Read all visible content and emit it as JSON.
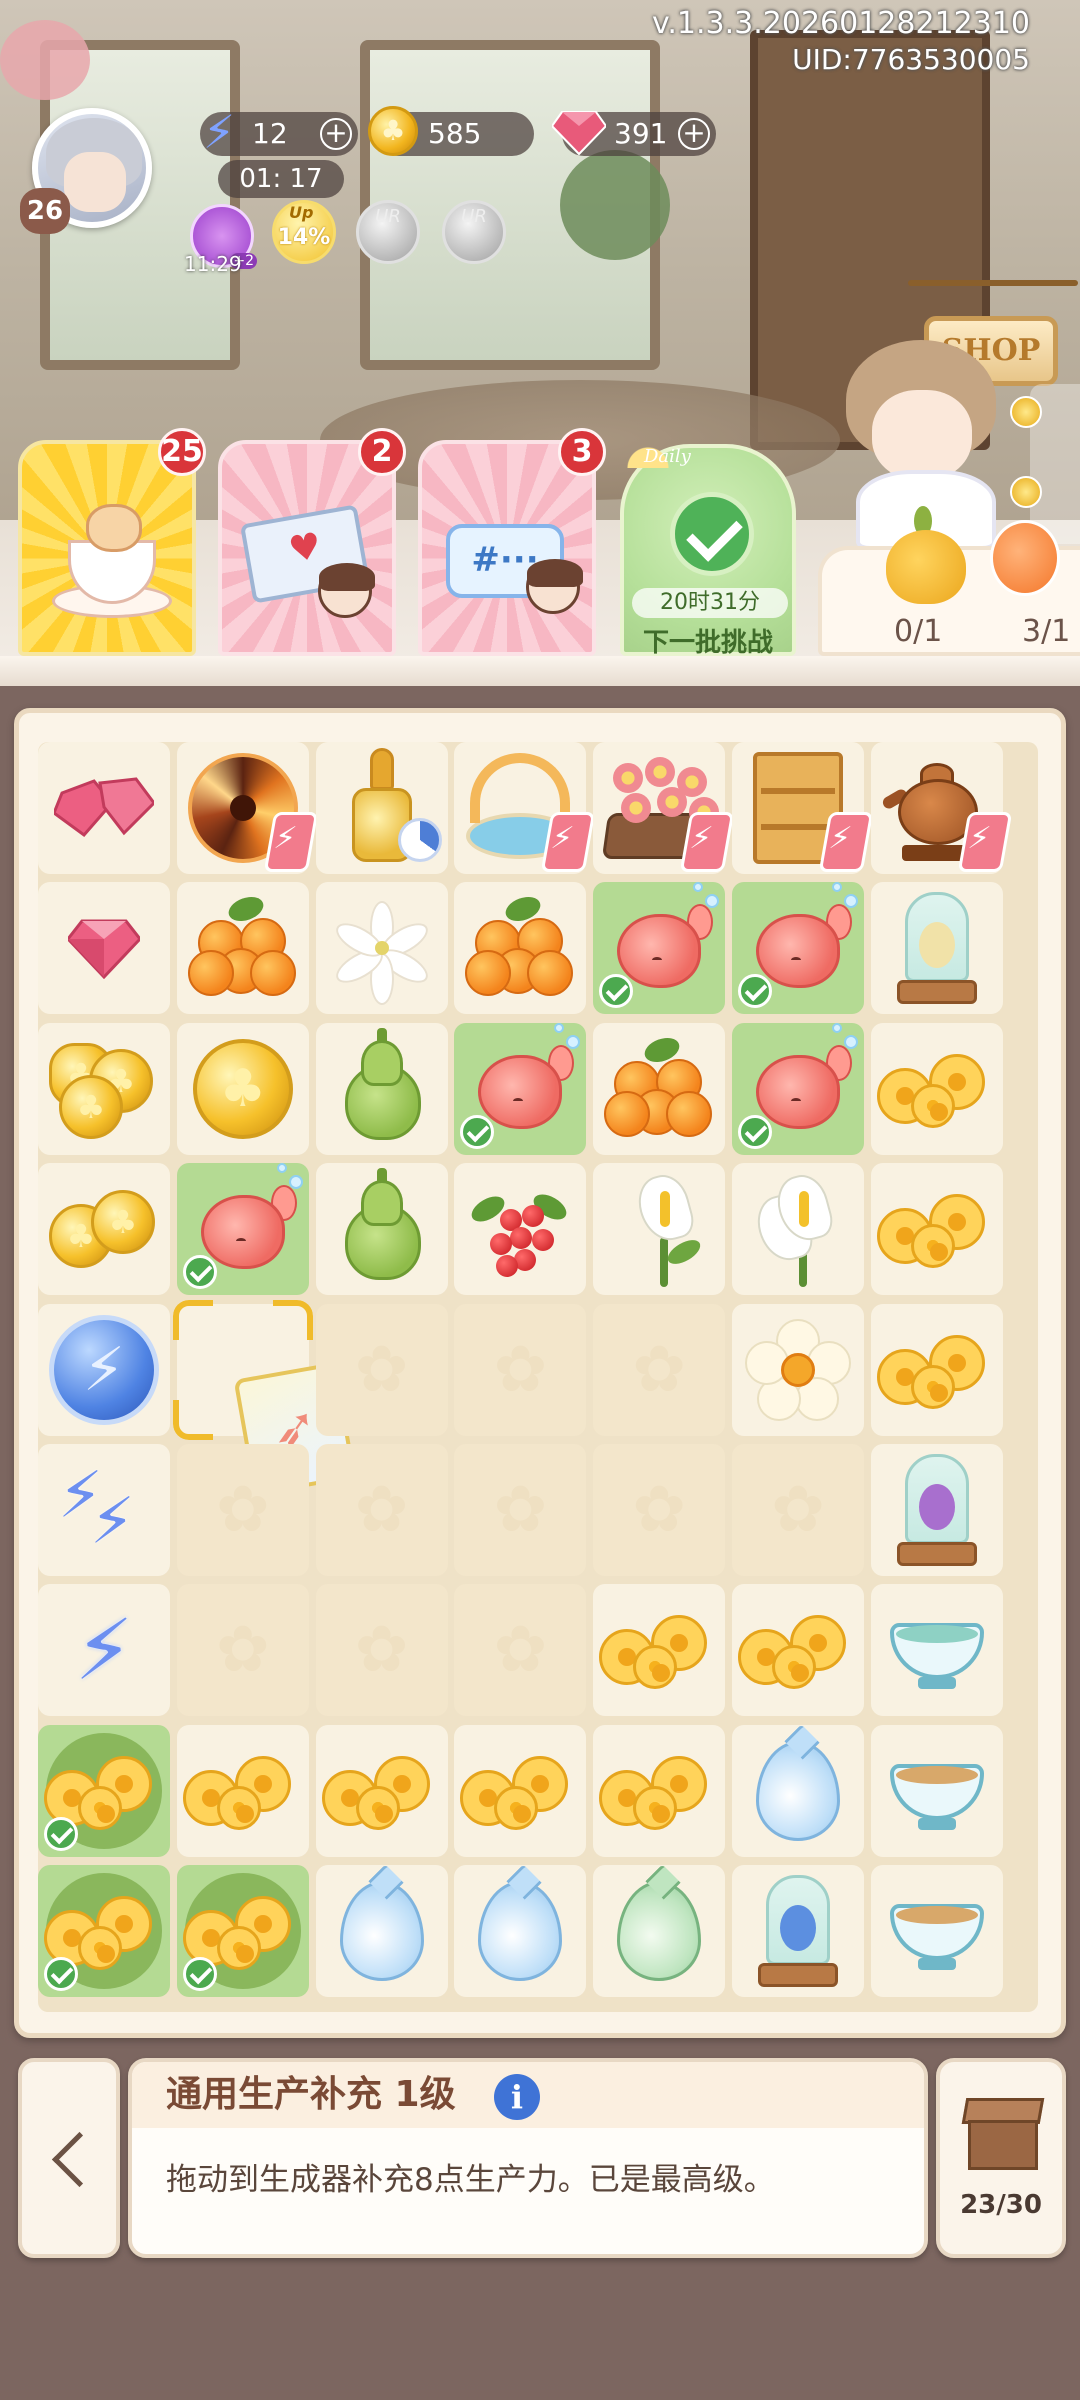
{
  "header": {
    "version": "v.1.3.3.20260128212310",
    "uid": "UID:7763530005"
  },
  "player": {
    "level": "26",
    "energy": "12",
    "energy_timer": "01: 17",
    "coins": "585",
    "gems": "391"
  },
  "buffs": {
    "purple_badge": "+2",
    "purple_timer": "11:29",
    "up_label": "Up",
    "up_percent": "14%",
    "ur_label_1": "UR",
    "ur_label_2": "UR"
  },
  "shop": {
    "label": "SHOP"
  },
  "orders": [
    {
      "name": "tea-order",
      "badge": "25"
    },
    {
      "name": "mail-order",
      "badge": "2"
    },
    {
      "name": "chat-order",
      "badge": "3"
    }
  ],
  "daily": {
    "script": "Daily",
    "time": "20时31分",
    "label": "下一批挑战"
  },
  "delivery": {
    "count_1": "0/1",
    "count_2": "3/1"
  },
  "item_info": {
    "title": "通用生产补充 1级",
    "info_symbol": "i",
    "description": "拖动到生成器补充8点生产力。已是最高级。"
  },
  "storage": {
    "count": "23/30"
  },
  "colors": {
    "check_green": "#4ca94f",
    "badge_red": "#d9353a",
    "board_bg": "#efe2c7",
    "done_cell": "#b4da93",
    "accent_blue": "#3f73d6"
  },
  "board": {
    "rows": 9,
    "cols": 7,
    "grid": [
      [
        "gems2",
        "vortex",
        "perfume",
        "garden",
        "flower-bed",
        "shelf",
        "teapot"
      ],
      [
        "gem",
        "oranges",
        "lily",
        "oranges",
        "fish",
        "fish",
        "jar-vanilla"
      ],
      [
        "coins-stack",
        "coin-big",
        "pear",
        "fish",
        "oranges",
        "fish",
        "flowers"
      ],
      [
        "coins-2",
        "fish",
        "pear",
        "berries",
        "calla",
        "calla2",
        "flowers"
      ],
      [
        "energy-ball",
        "scroll-card",
        "empty",
        "empty",
        "empty",
        "narcissus",
        "flowers"
      ],
      [
        "bolts2",
        "empty",
        "empty",
        "empty",
        "empty",
        "empty",
        "jar-purple"
      ],
      [
        "bolt",
        "empty",
        "empty",
        "empty",
        "flowers",
        "flowers",
        "tea-bowl-green"
      ],
      [
        "flowers-leaf",
        "flowers",
        "flowers",
        "flowers",
        "flowers",
        "drop",
        "tea-bowl"
      ],
      [
        "flowers-leaf",
        "flowers-leaf",
        "drop",
        "drop",
        "drop-green",
        "jar-blue",
        "tea-bowl"
      ]
    ],
    "done": [
      [
        1,
        4
      ],
      [
        1,
        5
      ],
      [
        2,
        3
      ],
      [
        2,
        5
      ],
      [
        3,
        1
      ],
      [
        7,
        0
      ],
      [
        8,
        0
      ],
      [
        8,
        1
      ]
    ],
    "generators_with_bolt": [
      [
        0,
        1
      ],
      [
        0,
        3
      ],
      [
        0,
        4
      ],
      [
        0,
        5
      ],
      [
        0,
        6
      ]
    ],
    "generators_with_timer": [
      [
        0,
        2
      ]
    ],
    "selected": [
      4,
      1
    ]
  }
}
